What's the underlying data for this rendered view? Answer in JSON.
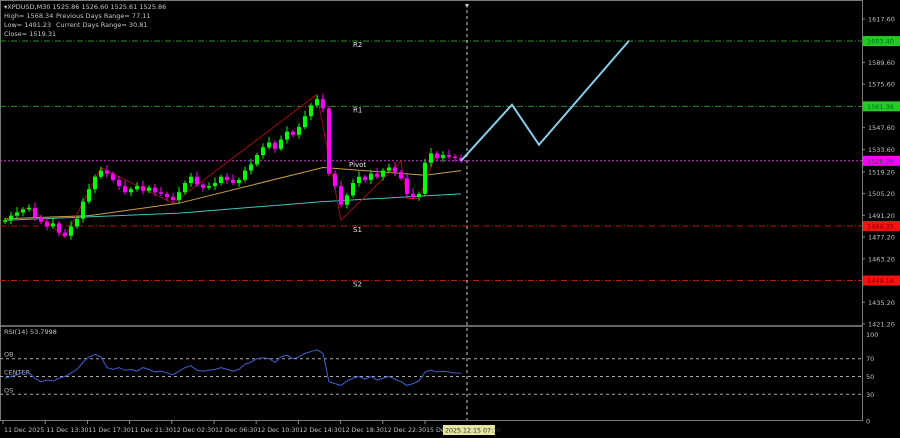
{
  "header": {
    "symbol_line": "XPDUSD,M30  1525.86 1526.60 1525.61 1525.86",
    "high": "High= 1568.34",
    "prev_range": "Previous Days Range= 77.11",
    "low": "Low= 1491.23",
    "curr_range": "Current Days Range= 30.81",
    "close": "Close= 1519.31"
  },
  "colors": {
    "bull": "#00ff00",
    "bear": "#ff00ff",
    "ma_fast": "#c8a040",
    "ma_slow": "#40c0c0",
    "zigzag": "#a01010",
    "projection": "#87ceeb",
    "rsi": "#4060d0",
    "resistance": "#2e8b2e",
    "support": "#c01010",
    "pivot": "#d040d0"
  },
  "price_axis": {
    "ticks": [
      "1617.60",
      "1589.60",
      "1575.60",
      "1547.60",
      "1533.60",
      "1519.20",
      "1505.20",
      "1491.20",
      "1477.20",
      "1463.20",
      "1435.20",
      "1421.20"
    ],
    "min": 1421.2,
    "max": 1617.6
  },
  "levels": [
    {
      "name": "R2",
      "price": 1603.4,
      "label": "1603.40",
      "type": "resistance"
    },
    {
      "name": "R1",
      "price": 1561.36,
      "label": "1561.36",
      "type": "resistance"
    },
    {
      "name": "Pivot",
      "price": 1526.29,
      "label": "1526.29",
      "type": "pivot"
    },
    {
      "name": "S1",
      "price": 1484.35,
      "label": "1484.35",
      "type": "support"
    },
    {
      "name": "S2",
      "price": 1449.18,
      "label": "1449.18",
      "type": "support"
    }
  ],
  "chart_data": {
    "type": "candlestick",
    "closes": [
      1488,
      1491,
      1493,
      1495,
      1496,
      1490,
      1487,
      1484,
      1486,
      1480,
      1478,
      1484,
      1489,
      1500,
      1508,
      1516,
      1520,
      1518,
      1514,
      1510,
      1506,
      1508,
      1510,
      1507,
      1509,
      1506,
      1505,
      1503,
      1501,
      1506,
      1512,
      1516,
      1511,
      1509,
      1510,
      1512,
      1516,
      1514,
      1512,
      1514,
      1520,
      1524,
      1530,
      1535,
      1538,
      1534,
      1540,
      1545,
      1543,
      1548,
      1555,
      1562,
      1566,
      1560,
      1518,
      1510,
      1498,
      1504,
      1512,
      1516,
      1514,
      1518,
      1516,
      1520,
      1522,
      1519,
      1515,
      1505,
      1503,
      1505,
      1525,
      1531,
      1528,
      1530,
      1529,
      1528,
      1526.3
    ],
    "ma_fast": [
      [
        0,
        1489
      ],
      [
        14,
        1491
      ],
      [
        29,
        1499
      ],
      [
        53,
        1522
      ],
      [
        70,
        1517
      ],
      [
        76,
        1520
      ]
    ],
    "ma_slow": [
      [
        0,
        1488
      ],
      [
        29,
        1492.6
      ],
      [
        53,
        1500
      ],
      [
        76,
        1505
      ]
    ],
    "zigzag": [
      [
        0,
        1488
      ],
      [
        4,
        1496.5
      ],
      [
        10,
        1477
      ],
      [
        16,
        1521.7
      ],
      [
        28,
        1499
      ],
      [
        52,
        1569
      ],
      [
        56,
        1488
      ],
      [
        66,
        1526
      ],
      [
        67,
        1502
      ],
      [
        69,
        1502
      ],
      [
        72,
        1532
      ]
    ],
    "projection": [
      [
        76,
        1526.3
      ],
      [
        84.5,
        1562.4
      ],
      [
        89,
        1536.6
      ],
      [
        104,
        1603.6
      ]
    ]
  },
  "rsi": {
    "title": "RSI(14) 53.7998",
    "levels": [
      {
        "label": "OB",
        "value": 70
      },
      {
        "label": "CENTER",
        "value": 50
      },
      {
        "label": "OS",
        "value": 30
      }
    ],
    "ticks": [
      "100",
      "70",
      "50",
      "30",
      "0"
    ],
    "values": [
      48,
      50,
      52,
      55,
      54,
      48,
      44,
      46,
      45,
      48,
      50,
      54,
      58,
      66,
      72,
      75,
      72,
      60,
      58,
      60,
      57,
      58,
      56,
      60,
      58,
      55,
      56,
      54,
      52,
      56,
      60,
      62,
      57,
      56,
      57,
      58,
      60,
      58,
      56,
      58,
      64,
      66,
      70,
      71,
      70,
      66,
      72,
      74,
      70,
      72,
      76,
      78,
      80,
      76,
      44,
      42,
      40,
      45,
      48,
      50,
      47,
      50,
      46,
      48,
      50,
      47,
      44,
      40,
      42,
      45,
      55,
      57,
      55,
      56,
      55,
      54,
      53.8
    ]
  },
  "time_axis": {
    "labels": [
      "11 Dec 2025",
      "11 Dec 13:30",
      "11 Dec 17:30",
      "11 Dec 21:30",
      "12 Dec 02:30",
      "12 Dec 06:30",
      "12 Dec 10:30",
      "12 Dec 14:30",
      "12 Dec 18:30",
      "12 Dec 22:30",
      "15 Dec"
    ],
    "cursor_label": "2025.12.15 07:30"
  }
}
